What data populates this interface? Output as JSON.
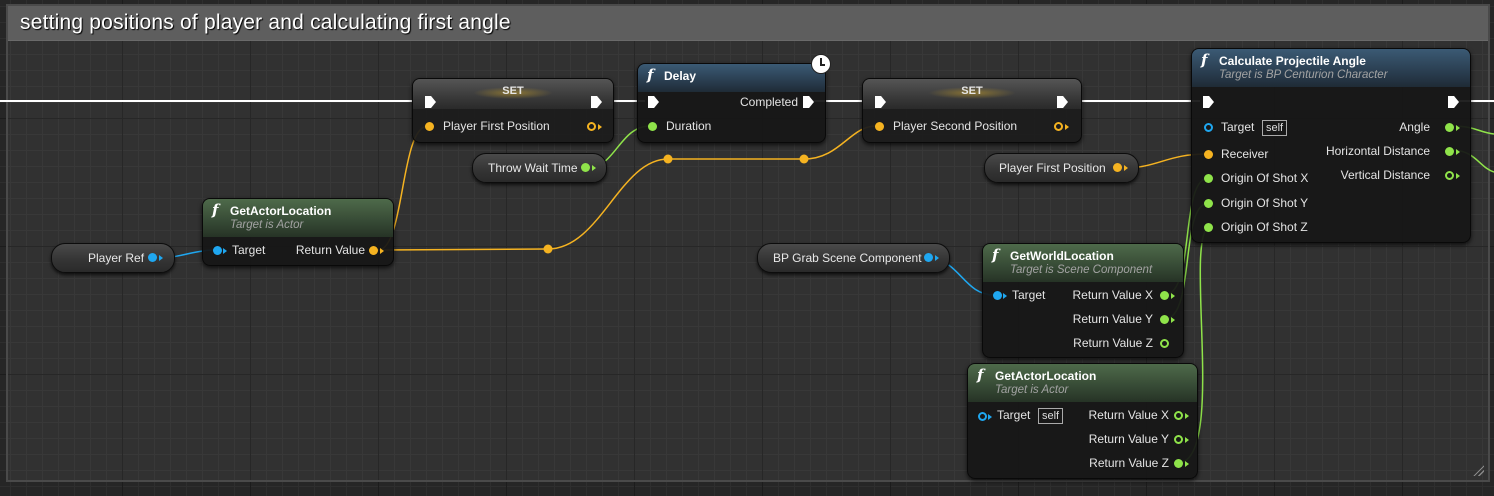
{
  "comment": {
    "title": "setting positions of player and calculating first angle"
  },
  "colors": {
    "exec": "#ffffff",
    "vector": "#f5b321",
    "float": "#8fe34a",
    "object": "#1fa7f0"
  },
  "nodes": {
    "set_first": {
      "title": "SET",
      "pin_in": "Player First Position"
    },
    "delay": {
      "icon": "function-icon",
      "title": "Delay",
      "completed": "Completed",
      "duration": "Duration",
      "latent_icon": "clock-icon"
    },
    "set_second": {
      "title": "SET",
      "pin_in": "Player Second Position"
    },
    "calc": {
      "icon": "function-icon",
      "title": "Calculate Projectile Angle",
      "subtitle": "Target is BP Centurion Character",
      "target": "Target",
      "self": "self",
      "receiver": "Receiver",
      "ox": "Origin Of Shot X",
      "oy": "Origin Of Shot Y",
      "oz": "Origin Of Shot Z",
      "angle": "Angle",
      "hdist": "Horizontal Distance",
      "vdist": "Vertical Distance"
    },
    "get_actor_loc_1": {
      "icon": "function-icon",
      "title": "GetActorLocation",
      "subtitle": "Target is Actor",
      "target": "Target",
      "ret": "Return Value"
    },
    "get_world_loc": {
      "icon": "function-icon",
      "title": "GetWorldLocation",
      "subtitle": "Target is Scene Component",
      "target": "Target",
      "rx": "Return Value X",
      "ry": "Return Value Y",
      "rz": "Return Value Z"
    },
    "get_actor_loc_2": {
      "icon": "function-icon",
      "title": "GetActorLocation",
      "subtitle": "Target is Actor",
      "target": "Target",
      "self": "self",
      "rx": "Return Value X",
      "ry": "Return Value Y",
      "rz": "Return Value Z"
    }
  },
  "variables": {
    "throw_wait_time": "Throw Wait Time",
    "player_first_position": "Player First Position",
    "player_ref": "Player Ref",
    "bp_grab_scene_component": "BP Grab Scene Component"
  }
}
